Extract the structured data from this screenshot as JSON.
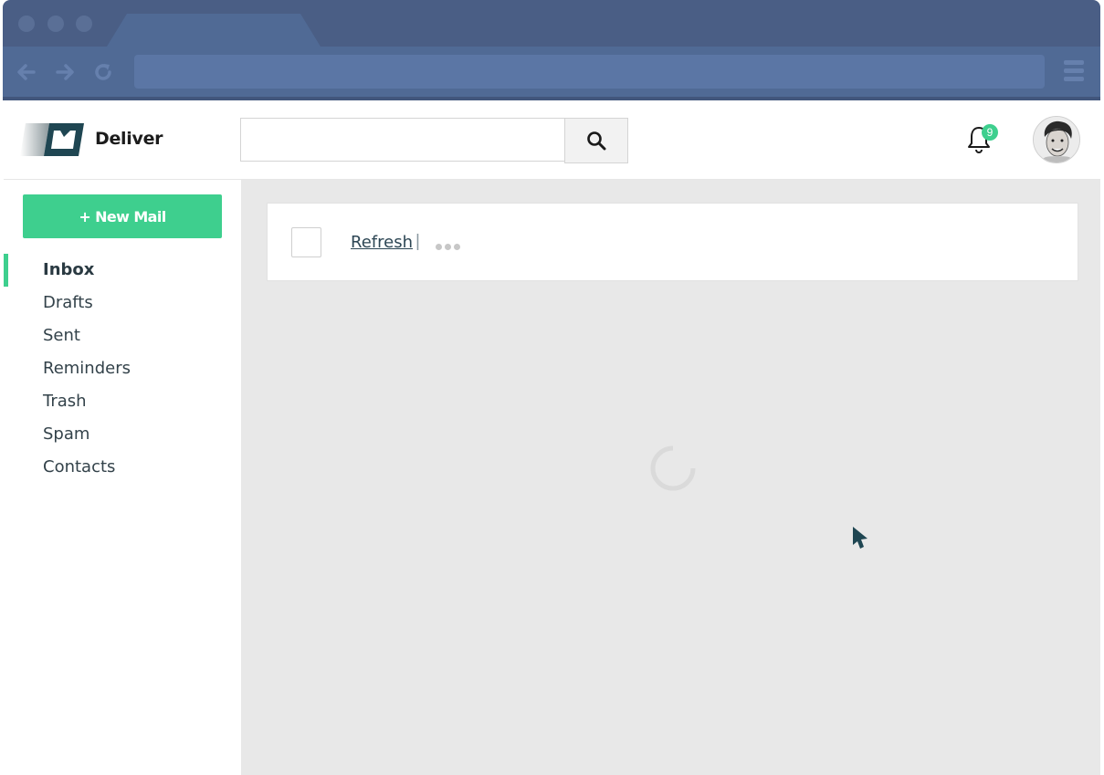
{
  "app": {
    "brand": "Deliver",
    "notifications_count": "9"
  },
  "search": {
    "placeholder": ""
  },
  "sidebar": {
    "new_mail_label": "+ New Mail",
    "items": [
      {
        "label": "Inbox",
        "active": true
      },
      {
        "label": "Drafts"
      },
      {
        "label": "Sent"
      },
      {
        "label": "Reminders"
      },
      {
        "label": "Trash"
      },
      {
        "label": "Spam"
      },
      {
        "label": "Contacts"
      }
    ]
  },
  "toolbar": {
    "refresh_label": "Refresh",
    "separator": "|"
  },
  "colors": {
    "accent": "#3ecf8e",
    "chrome": "#4a5e85",
    "main_bg": "#e8e8e8",
    "text_dark": "#2d4654"
  },
  "icons": [
    "back-arrow-icon",
    "forward-arrow-icon",
    "reload-icon",
    "menu-icon",
    "logo-icon",
    "search-icon",
    "bell-icon",
    "avatar",
    "more-dots-icon",
    "loading-spinner",
    "pointer-cursor-icon"
  ]
}
